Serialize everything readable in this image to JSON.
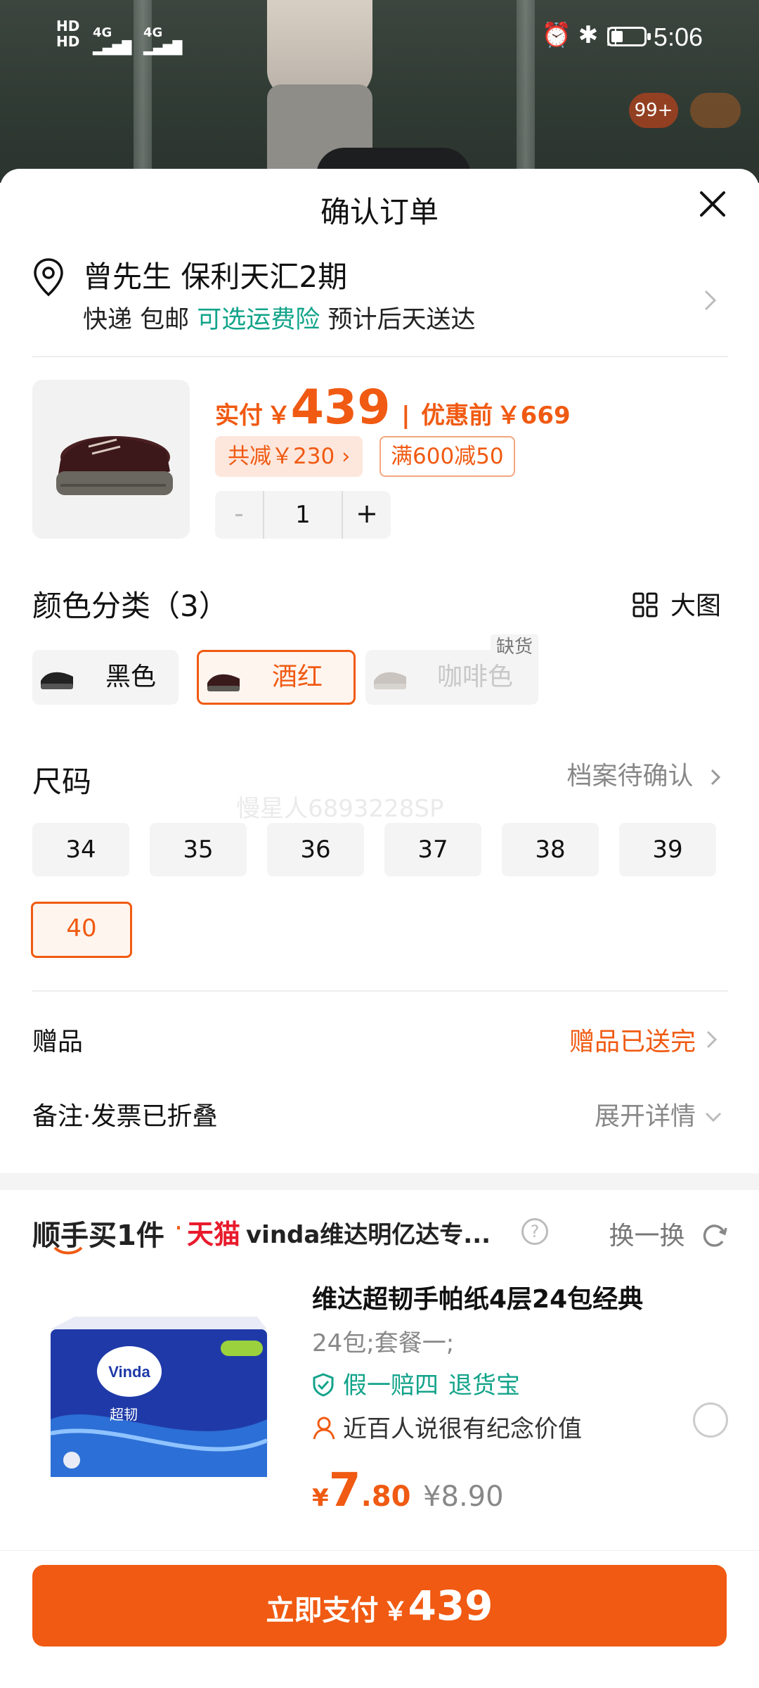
{
  "status_bar": {
    "time": "5:06",
    "signal_left": "HD 4G",
    "signal_right": "4G"
  },
  "background": {
    "badge_count": "99+"
  },
  "sheet": {
    "title": "确认订单"
  },
  "address": {
    "name_line": "曾先生 保利天汇2期",
    "delivery": "快递 包邮",
    "insurance": "可选运费险",
    "eta": "预计后天送达"
  },
  "product": {
    "paid_label": "实付",
    "currency": "￥",
    "paid_price": "439",
    "before_label": "优惠前",
    "before_price": "￥669",
    "reduction_tag": "共减￥230 ›",
    "coupon_tag": "满600减50",
    "quantity": "1",
    "minus": "-",
    "plus": "+"
  },
  "color_section": {
    "title": "颜色分类（3）",
    "big_view": "大图",
    "options": [
      {
        "label": "黑色",
        "state": "normal"
      },
      {
        "label": "酒红",
        "state": "selected"
      },
      {
        "label": "咖啡色",
        "state": "disabled",
        "badge": "缺货"
      }
    ]
  },
  "size_section": {
    "title": "尺码",
    "archive": "档案待确认",
    "watermark": "慢星人6893228SP",
    "sizes": [
      "34",
      "35",
      "36",
      "37",
      "38",
      "39",
      "40"
    ],
    "selected": "40"
  },
  "gift": {
    "label": "赠品",
    "value": "赠品已送完"
  },
  "note": {
    "label": "备注·发票已折叠",
    "value": "展开详情"
  },
  "addon": {
    "brand": "顺手买1件",
    "dot": "·",
    "tmall": "天猫",
    "shop": "vinda维达明亿达专...",
    "help": "?",
    "swap": "换一换",
    "title": "维达超韧手帕纸4层24包经典",
    "spec": "24包;套餐一;",
    "guarantee": "假一赔四",
    "return": "退货宝",
    "social": "近百人说很有纪念价值",
    "currency": "¥",
    "price_int": "7",
    "price_dec": ".80",
    "orig_price": "¥8.90"
  },
  "pay": {
    "label": "立即支付",
    "currency": "￥",
    "amount": "439"
  },
  "colors": {
    "accent": "#f05a12",
    "green": "#12a38a",
    "tmall_red": "#e81b2c"
  }
}
